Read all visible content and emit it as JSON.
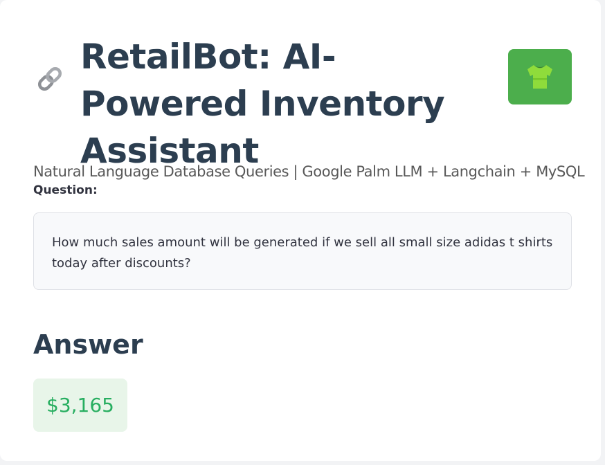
{
  "header": {
    "title": "RetailBot: AI-Powered Inventory Assistant",
    "title_icon": "link-icon",
    "logo_icon": "t-shirt-icon",
    "logo_color": "#4cae4c"
  },
  "subtitle": "Natural Language Database Queries | Google Palm LLM + Langchain + MySQL",
  "question": {
    "label": "Question:",
    "text": "How much sales amount will be generated if we sell all small size adidas t shirts today after discounts?"
  },
  "answer": {
    "heading": "Answer",
    "value": "$3,165",
    "value_color": "#27ae60",
    "box_color": "#e8f5e9"
  }
}
